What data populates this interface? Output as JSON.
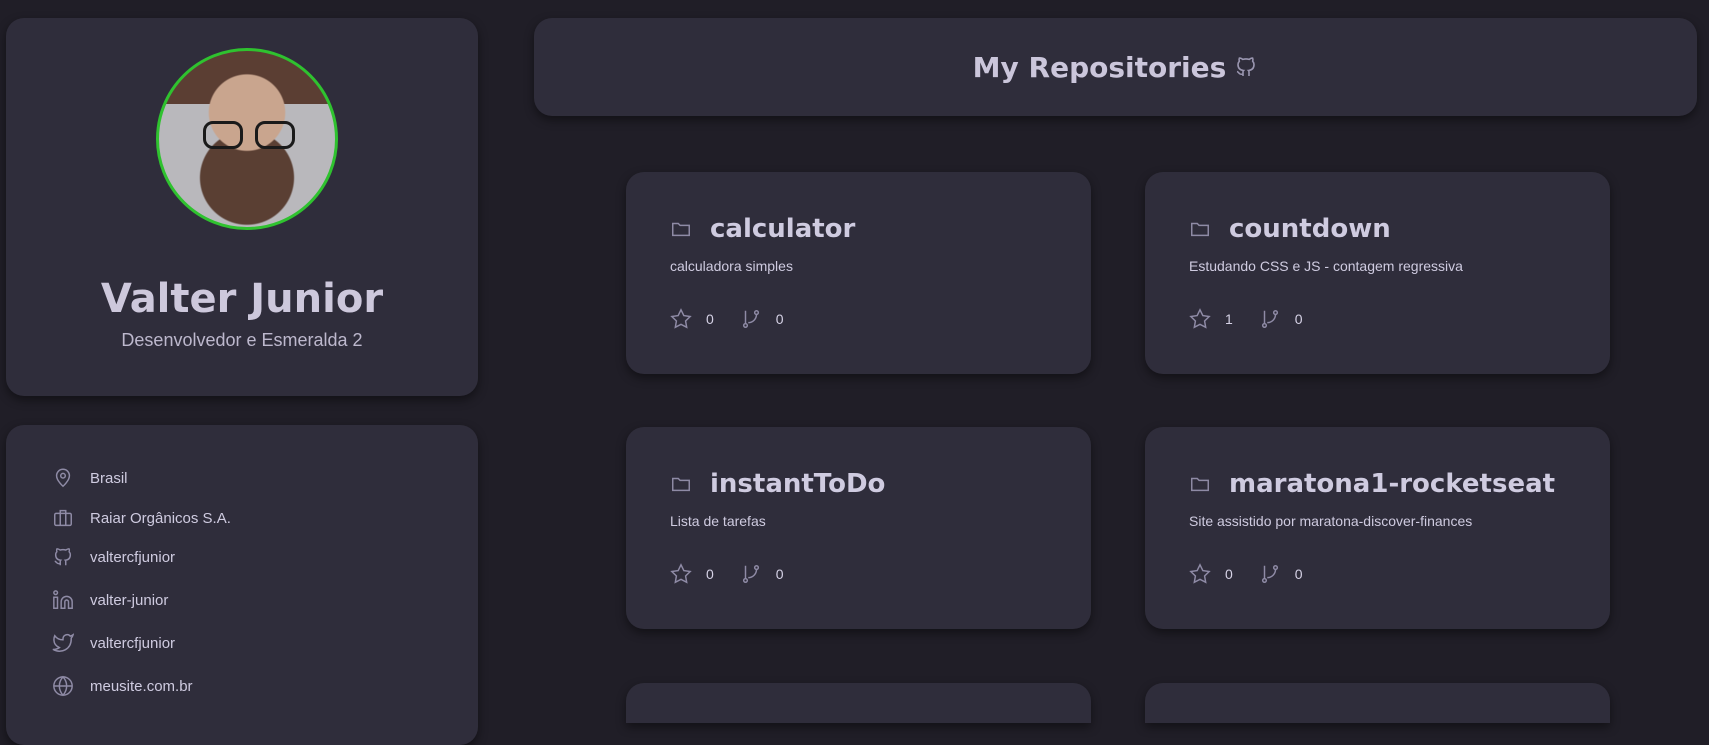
{
  "profile": {
    "name": "Valter Junior",
    "role": "Desenvolvedor e Esmeralda 2"
  },
  "info": {
    "location": "Brasil",
    "company": "Raiar Orgânicos S.A.",
    "github": "valtercfjunior",
    "linkedin": "valter-junior",
    "twitter": "valtercfjunior",
    "website": "meusite.com.br"
  },
  "header": {
    "title": "My Repositories"
  },
  "repos": [
    {
      "name": "calculator",
      "description": "calculadora simples",
      "stars": "0",
      "forks": "0"
    },
    {
      "name": "countdown",
      "description": "Estudando CSS e JS - contagem regressiva",
      "stars": "1",
      "forks": "0"
    },
    {
      "name": "instantToDo",
      "description": "Lista de tarefas",
      "stars": "0",
      "forks": "0"
    },
    {
      "name": "maratona1-rocketseat",
      "description": "Site assistido por maratona-discover-finances",
      "stars": "0",
      "forks": "0"
    }
  ],
  "colors": {
    "background": "#201e27",
    "card": "#2f2d3b",
    "avatar_border": "#2fc22f",
    "text": "#cfcbe0"
  }
}
